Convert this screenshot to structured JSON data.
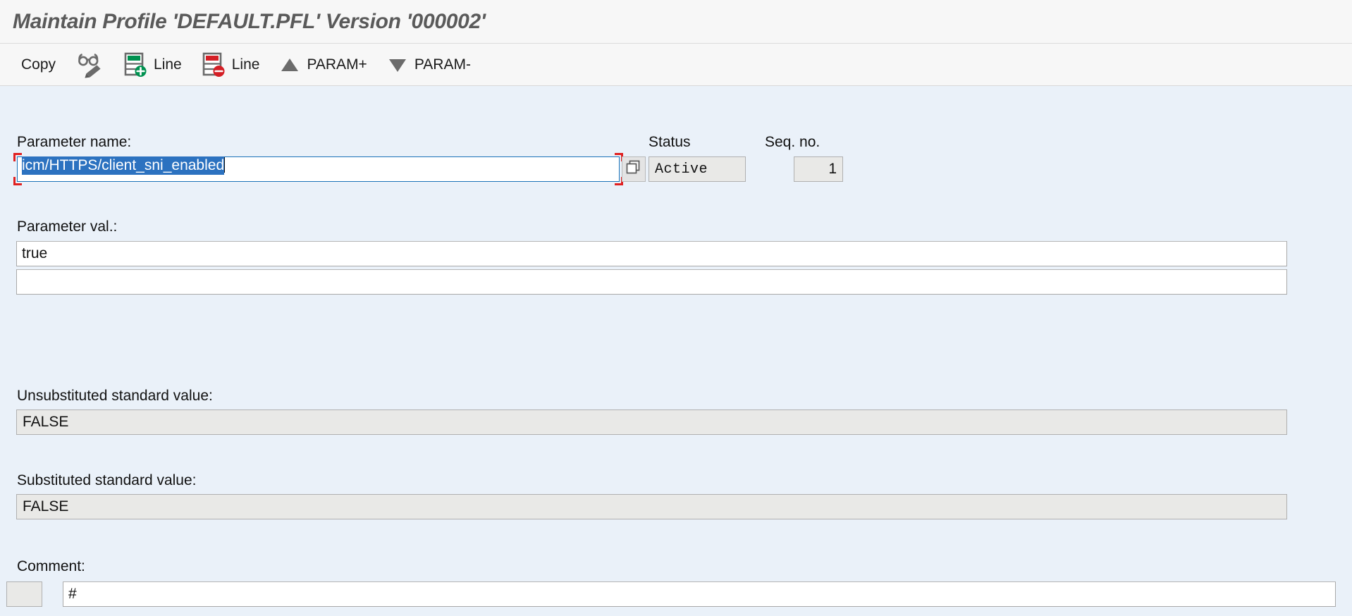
{
  "window": {
    "title": "Maintain Profile 'DEFAULT.PFL' Version '000002'"
  },
  "toolbar": {
    "items": [
      {
        "label": "Copy",
        "icon": "none"
      },
      {
        "label": "",
        "icon": "glasses-pencil-icon"
      },
      {
        "label": "Line",
        "icon": "insert-line-icon"
      },
      {
        "label": "Line",
        "icon": "delete-line-icon"
      },
      {
        "label": "PARAM+",
        "icon": "triangle-up-icon"
      },
      {
        "label": "PARAM-",
        "icon": "triangle-down-icon"
      }
    ]
  },
  "form": {
    "parameter_name": {
      "label": "Parameter name:",
      "value": "icm/HTTPS/client_sni_enabled",
      "selected": true,
      "required": true,
      "f4_icon": "value-help-icon"
    },
    "status": {
      "label": "Status",
      "value": "Active"
    },
    "seq_no": {
      "label": "Seq. no.",
      "value": "1"
    },
    "parameter_value": {
      "label": "Parameter val.:",
      "line1": "true",
      "line2": ""
    },
    "unsubstituted_standard_value": {
      "label": "Unsubstituted standard value:",
      "value": "FALSE"
    },
    "substituted_standard_value": {
      "label": "Substituted standard value:",
      "value": "FALSE"
    },
    "comment": {
      "label": "Comment:",
      "prefix": "",
      "value": "#"
    }
  },
  "colors": {
    "content_background": "#eaf1f9",
    "titlebar_background": "#f7f7f7",
    "title_text": "#5a5a5a",
    "focus_border": "#1a72b8",
    "required_marker": "#e02020",
    "selection": "#2c72c0",
    "readonly_background": "#e9e9e7",
    "icon_green": "#009150",
    "icon_red": "#d41f26",
    "icon_gray": "#6b6b6b"
  }
}
